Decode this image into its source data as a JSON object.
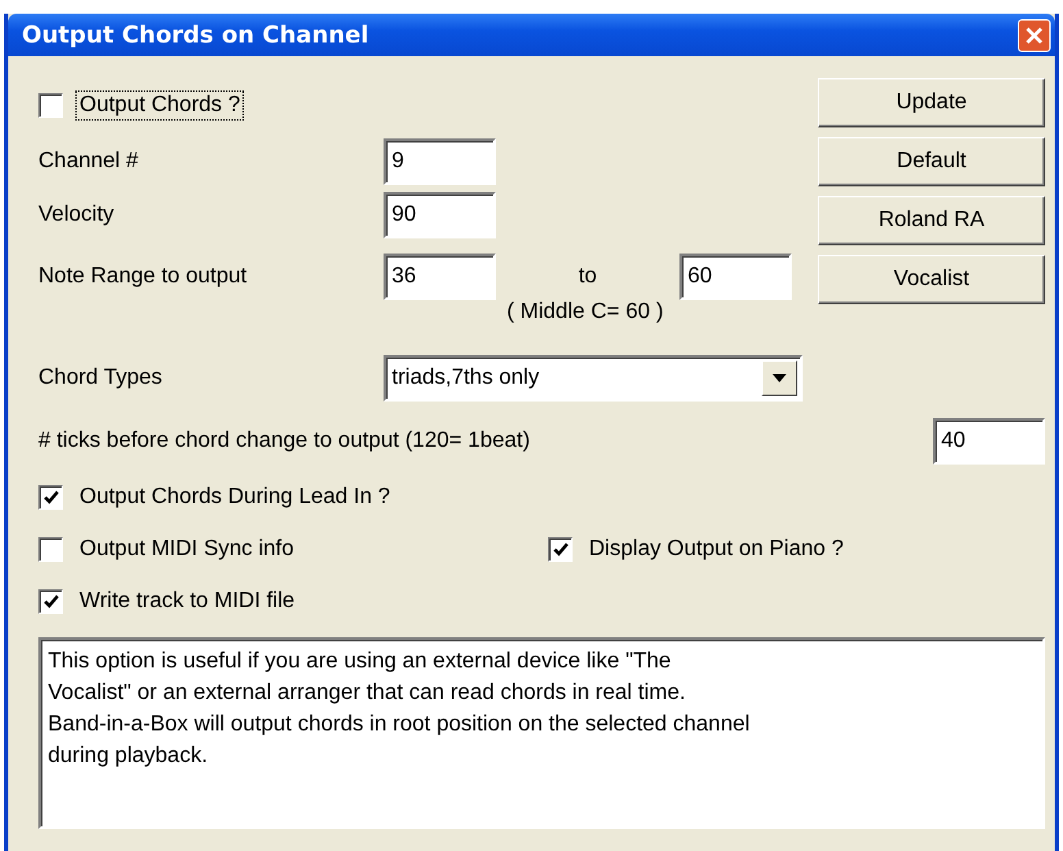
{
  "window": {
    "title": "Output Chords on Channel"
  },
  "output_chords": {
    "label": "Output Chords ?",
    "checked": false,
    "focused": true
  },
  "fields": [
    {
      "label": "Channel #",
      "value": "9"
    },
    {
      "label": "Velocity",
      "value": "90"
    }
  ],
  "note_range": {
    "label": "Note Range to output",
    "from": "36",
    "separator": "to",
    "to": "60",
    "hint": "( Middle C= 60 )"
  },
  "chord_types": {
    "label": "Chord Types",
    "value": "triads,7ths only"
  },
  "ticks": {
    "label": "# ticks before chord change to output (120= 1beat)",
    "value": "40"
  },
  "option_rows": [
    [
      {
        "label": "Output Chords During Lead In ?",
        "checked": true
      }
    ],
    [
      {
        "label": "Output MIDI Sync info",
        "checked": false
      },
      {
        "label": "Display Output on Piano ?",
        "checked": true
      }
    ],
    [
      {
        "label": "Write track to MIDI file",
        "checked": true
      }
    ]
  ],
  "buttons": [
    "Update",
    "Default",
    "Roland RA",
    "Vocalist"
  ],
  "description": "This option is useful if you are using an external device like \"The\nVocalist\" or an external arranger that can read chords in real time.\nBand-in-a-Box will output chords in root position on the selected channel\nduring playback."
}
